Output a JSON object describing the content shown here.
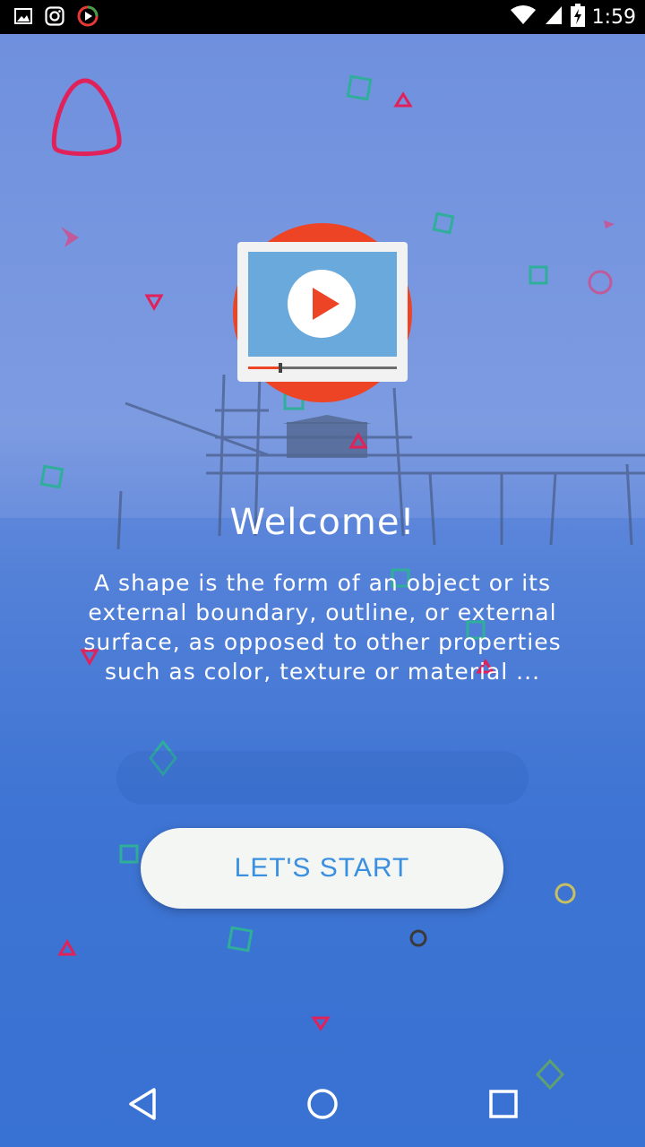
{
  "status_bar": {
    "time": "1:59",
    "left_icons": [
      "gallery-icon",
      "instagram-icon",
      "music-player-icon"
    ],
    "right_icons": [
      "wifi-icon",
      "signal-icon",
      "battery-charging-icon"
    ]
  },
  "welcome": {
    "title": "Welcome!",
    "description": "A shape is the form of an object or its external boundary, outline, or external surface, as opposed to other properties such as color, texture or material ..."
  },
  "start_button": {
    "label": "LET'S START"
  },
  "icons": {
    "hero": "video-player-icon",
    "nav": [
      "back-icon",
      "home-icon",
      "recents-icon"
    ]
  },
  "colors": {
    "accent_red": "#ee4426",
    "screen_blue": "#6aa9dc",
    "button_text": "#3a8fe0",
    "shape_pink": "#e0215a",
    "shape_teal": "#2fae9a"
  }
}
